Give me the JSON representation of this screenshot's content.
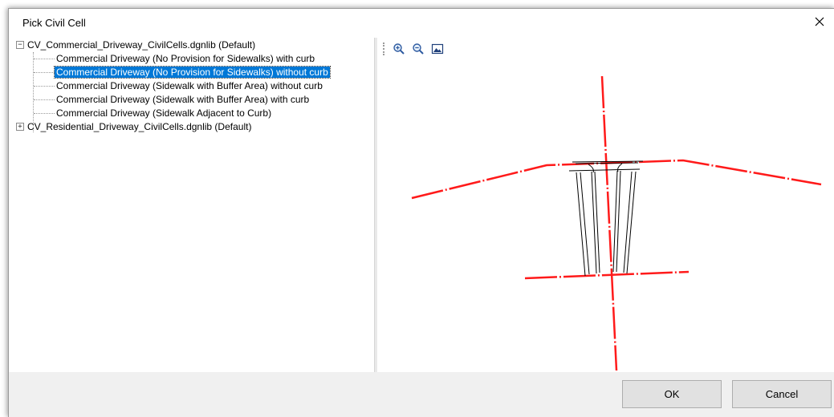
{
  "dialog": {
    "title": "Pick Civil Cell"
  },
  "tree": {
    "nodes": [
      {
        "label": "CV_Commercial_Driveway_CivilCells.dgnlib (Default)",
        "expander": "−"
      },
      {
        "label": "Commercial Driveway (No Provision for Sidewalks) with curb"
      },
      {
        "label": "Commercial Driveway (No Provision for Sidewalks) without curb",
        "selected": true
      },
      {
        "label": "Commercial Driveway (Sidewalk with Buffer Area) without curb"
      },
      {
        "label": "Commercial Driveway (Sidewalk with Buffer Area) with curb"
      },
      {
        "label": "Commercial Driveway (Sidewalk Adjacent to Curb)"
      },
      {
        "label": "CV_Residential_Driveway_CivilCells.dgnlib (Default)",
        "expander": "+"
      }
    ]
  },
  "toolbar": {
    "icons": [
      "zoom-in-icon",
      "zoom-out-icon",
      "fit-view-icon"
    ]
  },
  "buttons": {
    "ok": "OK",
    "cancel": "Cancel"
  },
  "colors": {
    "selection": "#0078d7",
    "preview_red": "#ff1a1a",
    "preview_black": "#000000"
  }
}
